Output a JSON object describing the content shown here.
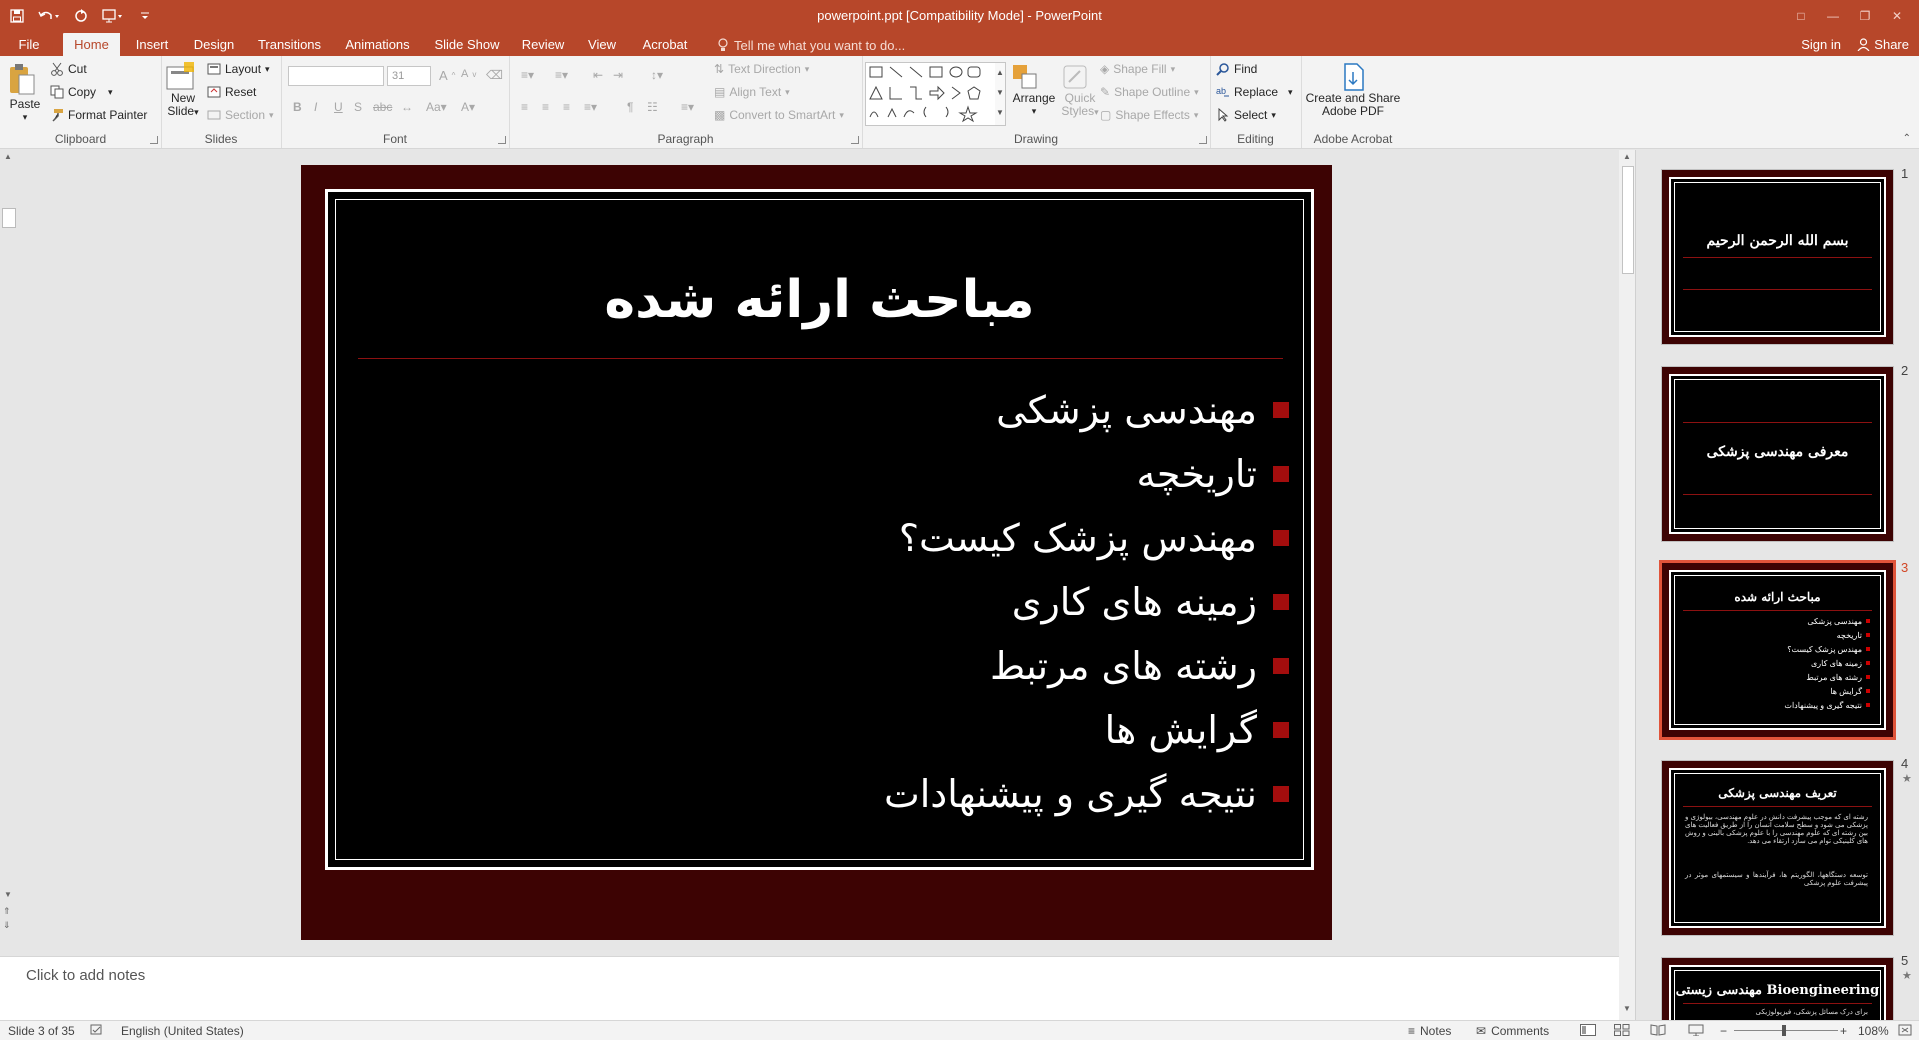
{
  "window": {
    "title": "powerpoint.ppt [Compatibility Mode] - PowerPoint"
  },
  "tabs": {
    "items": [
      "File",
      "Home",
      "Insert",
      "Design",
      "Transitions",
      "Animations",
      "Slide Show",
      "Review",
      "View",
      "Acrobat"
    ],
    "active": "Home",
    "tell_me": "Tell me what you want to do...",
    "sign_in": "Sign in",
    "share": "Share"
  },
  "ribbon": {
    "clipboard": {
      "label": "Clipboard",
      "paste": "Paste",
      "cut": "Cut",
      "copy": "Copy",
      "format_painter": "Format Painter"
    },
    "slides": {
      "label": "Slides",
      "new_slide_1": "New",
      "new_slide_2": "Slide",
      "layout": "Layout",
      "reset": "Reset",
      "section": "Section"
    },
    "font": {
      "label": "Font",
      "font_size": "31"
    },
    "paragraph": {
      "label": "Paragraph",
      "text_direction": "Text Direction",
      "align_text": "Align Text",
      "convert_smartart": "Convert to SmartArt"
    },
    "drawing": {
      "label": "Drawing",
      "arrange": "Arrange",
      "quick_styles_1": "Quick",
      "quick_styles_2": "Styles",
      "shape_fill": "Shape Fill",
      "shape_outline": "Shape Outline",
      "shape_effects": "Shape Effects"
    },
    "editing": {
      "label": "Editing",
      "find": "Find",
      "replace": "Replace",
      "select": "Select"
    },
    "acrobat": {
      "label": "Adobe Acrobat",
      "create_1": "Create and Share",
      "create_2": "Adobe PDF"
    }
  },
  "slide": {
    "title": "مباحث ارائه شده",
    "bullets": [
      "مهندسی پزشکی",
      "تاریخچه",
      "مهندس پزشک کیست؟",
      "زمینه های کاری",
      "رشته های مرتبط",
      "گرایش ها",
      "نتیجه گیری و پیشنهادات"
    ]
  },
  "notes": {
    "placeholder": "Click to add notes"
  },
  "thumbnails": [
    {
      "number": "1",
      "title": "بسم الله الرحمن الرحيم"
    },
    {
      "number": "2",
      "title": "معرفی مهندسی پزشکی"
    },
    {
      "number": "3",
      "title": "مباحث ارائه شده",
      "bullets": [
        "مهندسی پزشکی",
        "تاریخچه",
        "مهندس پزشک کیست؟",
        "زمینه های کاری",
        "رشته های مرتبط",
        "گرایش ها",
        "نتیجه گیری و پیشنهادات"
      ]
    },
    {
      "number": "4",
      "title": "تعریف مهندسی پزشکی",
      "p1": "رشته ای که موجب پیشرفت دانش در علوم مهندسی، بیولوژی و پزشکی می شود و سطح سلامت انسان را از طریق فعالیت های بین رشته ای که علوم مهندسی را با علوم پزشکی بالینی و روش های کلینیکی توام می سازد ارتقاء می دهد.",
      "p2": "توسعه دستگاهها، الگوریتم ها، فرآیندها و سیستمهای موثر در پیشرفت علوم پزشکی"
    },
    {
      "number": "5",
      "title": "Bioengineering مهندسی زیستی",
      "p1": "برای درک مسائل پزشکی، فیزیولوژیکی"
    }
  ],
  "status": {
    "slide_info": "Slide 3 of 35",
    "language": "English (United States)",
    "notes": "Notes",
    "comments": "Comments",
    "zoom": "108%"
  }
}
